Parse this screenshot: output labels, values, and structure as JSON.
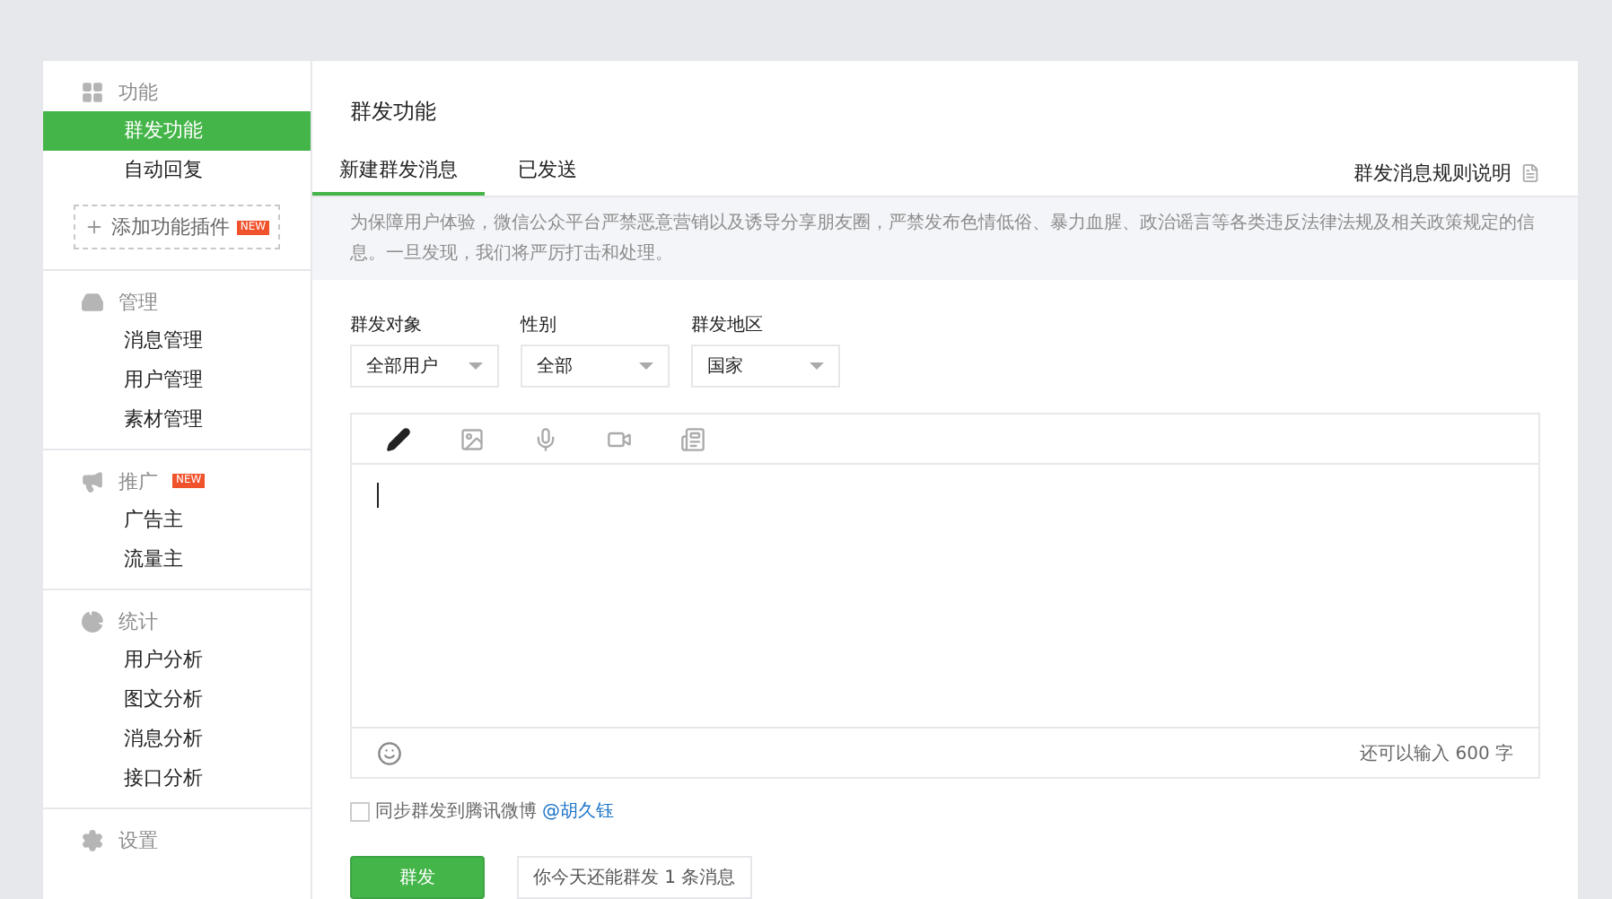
{
  "sidebar": {
    "sections": [
      {
        "title": "功能",
        "items": [
          {
            "label": "群发功能",
            "selected": true
          },
          {
            "label": "自动回复",
            "selected": false
          }
        ],
        "plugin": {
          "label": "添加功能插件",
          "badge": "NEW"
        }
      },
      {
        "title": "管理",
        "items": [
          {
            "label": "消息管理",
            "selected": false
          },
          {
            "label": "用户管理",
            "selected": false
          },
          {
            "label": "素材管理",
            "selected": false
          }
        ]
      },
      {
        "title": "推广",
        "badge": "NEW",
        "items": [
          {
            "label": "广告主",
            "selected": false
          },
          {
            "label": "流量主",
            "selected": false
          }
        ]
      },
      {
        "title": "统计",
        "items": [
          {
            "label": "用户分析",
            "selected": false
          },
          {
            "label": "图文分析",
            "selected": false
          },
          {
            "label": "消息分析",
            "selected": false
          },
          {
            "label": "接口分析",
            "selected": false
          }
        ]
      },
      {
        "title": "设置"
      }
    ]
  },
  "main": {
    "title": "群发功能",
    "tabs": [
      {
        "label": "新建群发消息",
        "selected": true
      },
      {
        "label": "已发送",
        "selected": false
      }
    ],
    "rules_link": "群发消息规则说明",
    "notice": "为保障用户体验，微信公众平台严禁恶意营销以及诱导分享朋友圈，严禁发布色情低俗、暴力血腥、政治谣言等各类违反法律法规及相关政策规定的信息。一旦发现，我们将严厉打击和处理。",
    "filters": [
      {
        "label": "群发对象",
        "value": "全部用户"
      },
      {
        "label": "性别",
        "value": "全部"
      },
      {
        "label": "群发地区",
        "value": "国家"
      }
    ],
    "editor": {
      "tools": [
        {
          "kind": "text",
          "selected": true
        },
        {
          "kind": "image",
          "selected": false
        },
        {
          "kind": "voice",
          "selected": false
        },
        {
          "kind": "video",
          "selected": false
        },
        {
          "kind": "article",
          "selected": false
        }
      ],
      "counter": "还可以输入 600 字"
    },
    "sync": {
      "checked": false,
      "label": "同步群发到腾讯微博",
      "account": "@胡久钰"
    },
    "send_button": "群发",
    "quota": "你今天还能群发 1 条消息"
  }
}
